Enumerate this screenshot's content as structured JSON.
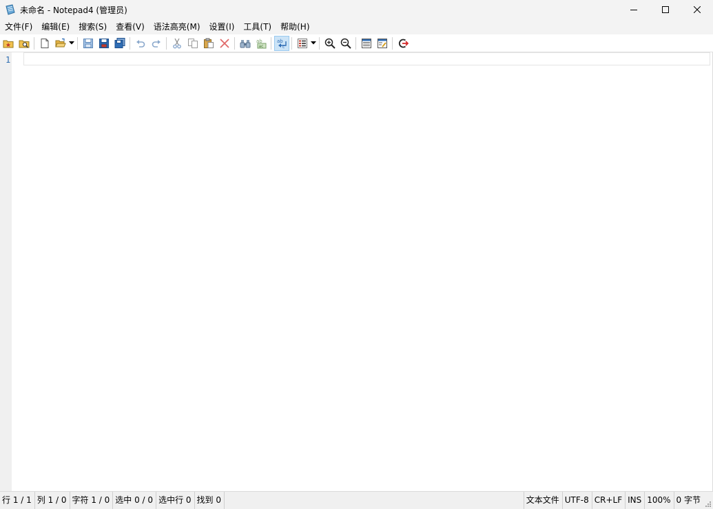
{
  "window": {
    "title": "未命名 - Notepad4 (管理员)",
    "controls": [
      "minimize",
      "maximize",
      "close"
    ]
  },
  "menu": {
    "items": [
      "文件(F)",
      "编辑(E)",
      "搜索(S)",
      "查看(V)",
      "语法高亮(M)",
      "设置(I)",
      "工具(T)",
      "帮助(H)"
    ]
  },
  "toolbar": {
    "buttons": [
      {
        "icon": "favorites-icon"
      },
      {
        "icon": "browse-icon"
      },
      {
        "icon": "new-file-icon"
      },
      {
        "icon": "open-folder-icon",
        "dropdown": true
      },
      {
        "icon": "save-icon"
      },
      {
        "icon": "save-as-icon"
      },
      {
        "icon": "save-copy-icon"
      },
      {
        "icon": "undo-icon"
      },
      {
        "icon": "redo-icon"
      },
      {
        "icon": "cut-icon"
      },
      {
        "icon": "copy-icon"
      },
      {
        "icon": "paste-icon"
      },
      {
        "icon": "delete-icon"
      },
      {
        "icon": "find-icon"
      },
      {
        "icon": "replace-icon"
      },
      {
        "icon": "word-wrap-icon",
        "active": true
      },
      {
        "icon": "scheme-icon",
        "dropdown": true
      },
      {
        "icon": "zoom-in-icon"
      },
      {
        "icon": "zoom-out-icon"
      },
      {
        "icon": "view-options-icon"
      },
      {
        "icon": "settings-icon"
      },
      {
        "icon": "exit-icon"
      }
    ]
  },
  "editor": {
    "line_numbers": [
      "1"
    ],
    "content": ""
  },
  "status": {
    "line": "行 1 / 1",
    "column": "列 1 / 0",
    "chars": "字符 1 / 0",
    "selection": "选中 0 / 0",
    "selected_lines": "选中行 0",
    "matches": "找到 0",
    "file_type": "文本文件",
    "encoding": "UTF-8",
    "line_endings": "CR+LF",
    "insert_mode": "INS",
    "zoom": "100%",
    "bytes": "0 字节"
  },
  "colors": {
    "chrome": "#f3f3f3",
    "line_number": "#2b6cb0",
    "blue_icon": "#2f6db5",
    "red_icon": "#d42a2a"
  }
}
